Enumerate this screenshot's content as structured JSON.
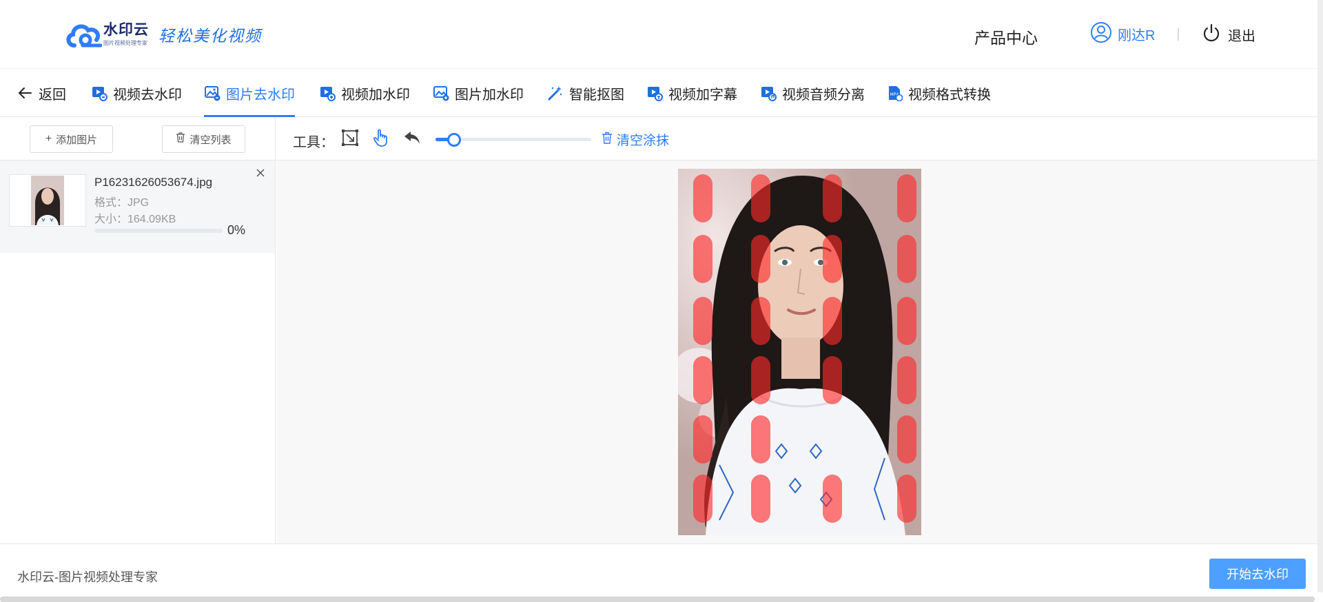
{
  "header": {
    "logo_name": "水印云",
    "logo_sub": "图片视频处理专家",
    "slogan": "轻松美化视频",
    "product_center": "产品中心",
    "user_name": "刚达R",
    "logout": "退出"
  },
  "tabs": {
    "back": "返回",
    "items": [
      {
        "label": "视频去水印",
        "icon": "video-remove-watermark-icon"
      },
      {
        "label": "图片去水印",
        "icon": "image-remove-watermark-icon",
        "active": true
      },
      {
        "label": "视频加水印",
        "icon": "video-add-watermark-icon"
      },
      {
        "label": "图片加水印",
        "icon": "image-add-watermark-icon"
      },
      {
        "label": "智能抠图",
        "icon": "magic-wand-icon"
      },
      {
        "label": "视频加字幕",
        "icon": "video-subtitle-icon"
      },
      {
        "label": "视频音频分离",
        "icon": "audio-separate-icon"
      },
      {
        "label": "视频格式转换",
        "icon": "mp4-convert-icon"
      }
    ]
  },
  "left": {
    "add_image": "添加图片",
    "clear_list": "清空列表",
    "file": {
      "name": "P16231626053674.jpg",
      "format": "格式：JPG",
      "size": "大小：164.09KB",
      "progress": 0,
      "progress_text": "0%"
    }
  },
  "toolbar": {
    "tools_label": "工具：",
    "slider_value": 0.12,
    "clear_brush": "清空涂抹"
  },
  "footer": {
    "text": "水印云-图片视频处理专家",
    "start_button": "开始去水印"
  },
  "colors": {
    "accent": "#2f7cf6",
    "primary_button": "#4da0ff",
    "brush_mark": "#ff2a2a"
  }
}
